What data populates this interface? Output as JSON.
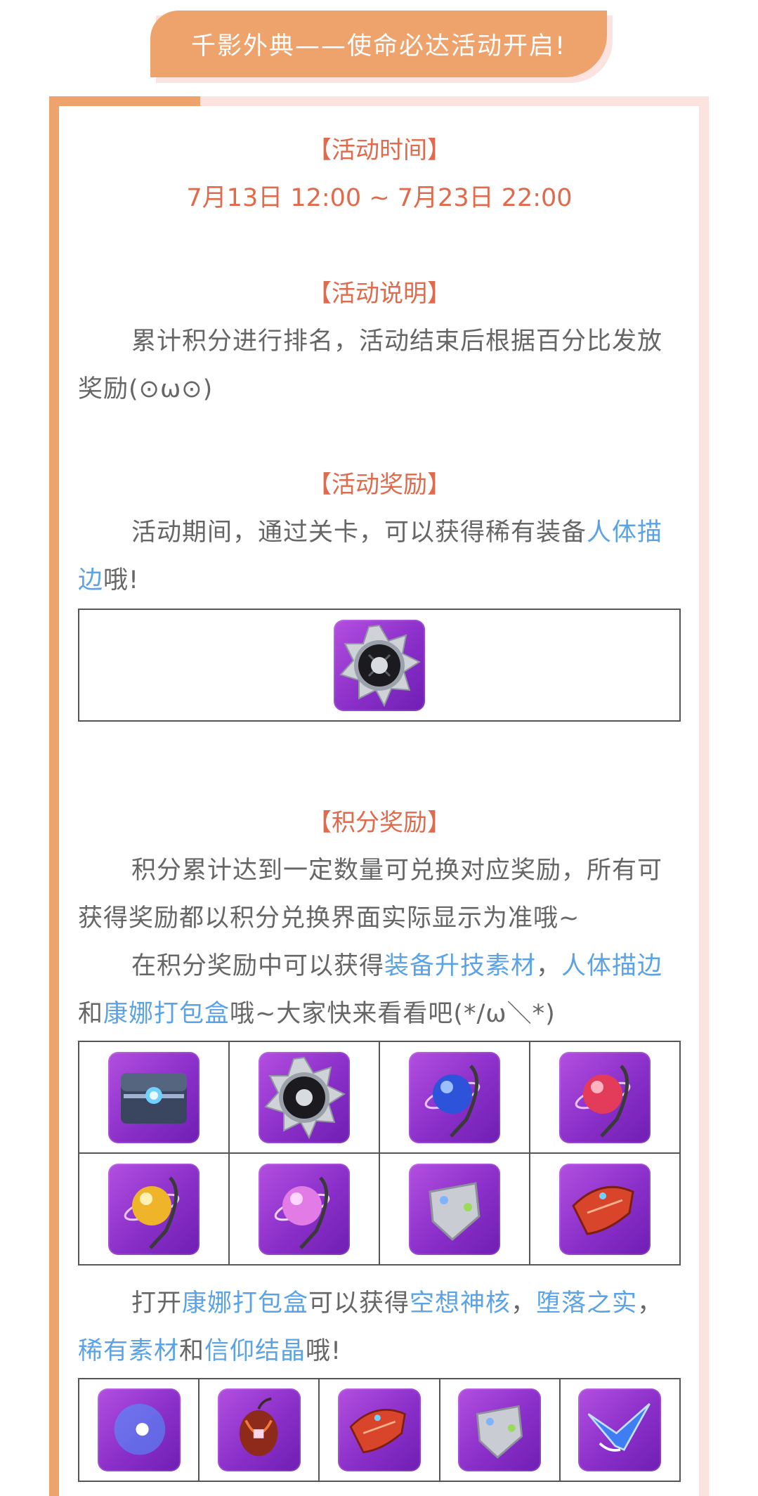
{
  "header": {
    "title": "千影外典——使命必达活动开启!"
  },
  "sections": {
    "time": {
      "title": "【活动时间】",
      "range": "7月13日 12:00 ~ 7月23日 22:00"
    },
    "desc": {
      "title": "【活动说明】",
      "text": "累计积分进行排名，活动结束后根据百分比发放奖励(⊙ω⊙)"
    },
    "reward": {
      "title": "【活动奖励】",
      "text_before": "活动期间，通过关卡，可以获得稀有装备",
      "link": "人体描边",
      "text_after": "哦!"
    },
    "points": {
      "title": "【积分奖励】",
      "text1": "积分累计达到一定数量可兑换对应奖励，所有可获得奖励都以积分兑换界面实际显示为准哦~",
      "text2_a": "在积分奖励中可以获得",
      "link_a": "装备升技素材",
      "sep_a": "，",
      "link_b": "人体描边",
      "text2_b": "和",
      "link_c": "康娜打包盒",
      "text2_c": "哦~大家快来看看吧(*/ω＼*)"
    },
    "box": {
      "t1": "打开",
      "link_a": "康娜打包盒",
      "t2": "可以获得",
      "link_b": "空想神核",
      "sep1": "，",
      "link_c": "堕落之实",
      "sep2": "，",
      "link_d": "稀有素材",
      "t3": "和",
      "link_e": "信仰结晶",
      "t4": "哦!"
    }
  },
  "icons": {
    "reward": "badge-icon",
    "grid4_row1": [
      "chest-icon",
      "badge-icon",
      "blue-orb-icon",
      "red-orb-icon"
    ],
    "grid4_row2": [
      "yellow-orb-icon",
      "pink-orb-icon",
      "silver-shard-icon",
      "red-shard-icon"
    ],
    "grid5": [
      "crescent-core-icon",
      "fallen-fruit-icon",
      "red-shard-icon",
      "silver-shard-icon",
      "blue-crystal-icon"
    ]
  },
  "colors": {
    "accent_orange": "#eea36c",
    "title_red": "#e06a4b",
    "link_blue": "#5ba3e6",
    "icon_purple": "#9b3fd6"
  }
}
